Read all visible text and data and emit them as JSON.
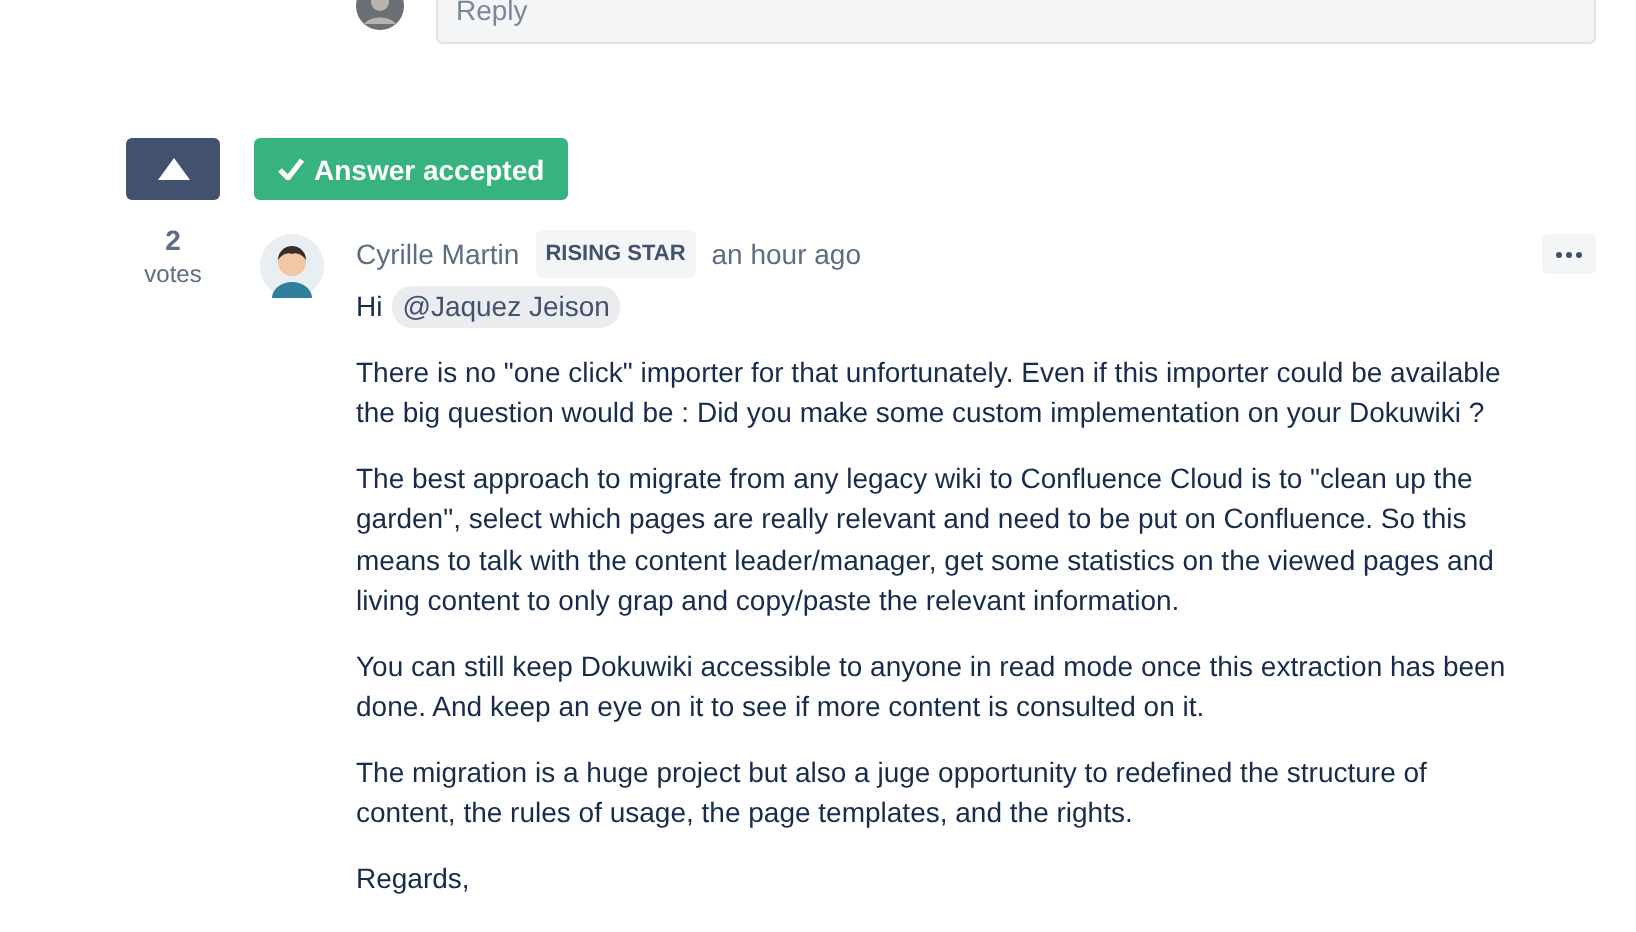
{
  "reply_box": {
    "placeholder": "Reply"
  },
  "vote": {
    "voted": true,
    "count": "2",
    "label": "votes"
  },
  "accepted": {
    "label": "Answer accepted"
  },
  "answer": {
    "author": "Cyrille Martin",
    "badge": "RISING STAR",
    "time": "an hour ago",
    "greeting": "Hi",
    "mention": "@Jaquez Jeison",
    "paragraphs": [
      "There is no \"one click\" importer for that unfortunately. Even if this importer could be available the big question would be : Did you make some custom implementation on your Dokuwiki ?",
      "The best approach to migrate from any legacy wiki to Confluence Cloud is to \"clean up the garden\", select which pages are really relevant and need to be put on Confluence. So this means to talk with the content leader/manager, get some statistics on the viewed pages and living content to only grap and copy/paste the relevant information.",
      "You can still keep Dokuwiki accessible to anyone in read mode once this extraction has been done. And keep an eye on it to see if more content is consulted on it.",
      "The migration is a huge project but also a juge opportunity to redefined the structure of content, the rules of usage, the page templates, and the rights."
    ],
    "signoff": "Regards,"
  }
}
